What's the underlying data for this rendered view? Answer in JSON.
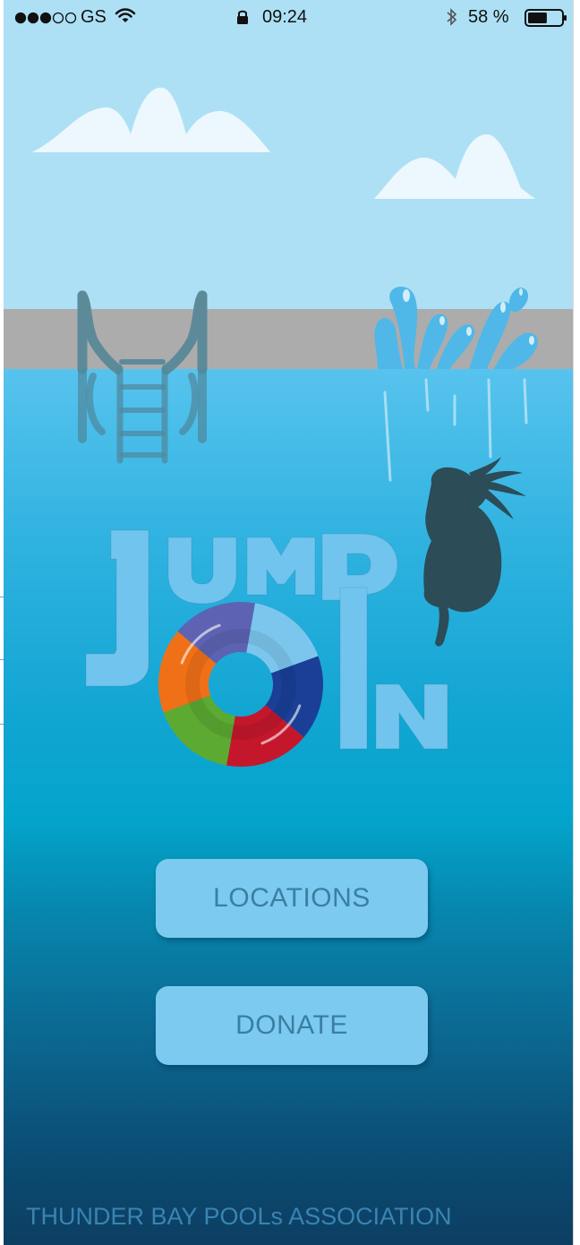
{
  "status_bar": {
    "carrier": "GS",
    "time": "09:24",
    "battery_percent": "58 %",
    "battery_level": 0.58,
    "signal_dots_filled": 3,
    "signal_dots_total": 5
  },
  "logo": {
    "word_top": "JUMP",
    "word_bottom": "IN",
    "ring_colors": [
      "#7cc6ee",
      "#1b3f96",
      "#c5172c",
      "#5daa32",
      "#f07018",
      "#5d63b2"
    ]
  },
  "buttons": {
    "locations_label": "LOCATIONS",
    "donate_label": "DONATE"
  },
  "footer": {
    "organization": "THUNDER BAY POOLs ASSOCIATION"
  },
  "colors": {
    "sky": "#ade0f5",
    "deck": "#acacac",
    "button": "#7ccaf0",
    "button_text": "#3b7fa0",
    "footer_text": "#3a84b2",
    "logo_letters": "#71c4ee",
    "silhouette": "#2c4c58"
  },
  "icons": [
    "signal-dots-icon",
    "wifi-icon",
    "lock-icon",
    "bluetooth-icon",
    "battery-icon"
  ]
}
